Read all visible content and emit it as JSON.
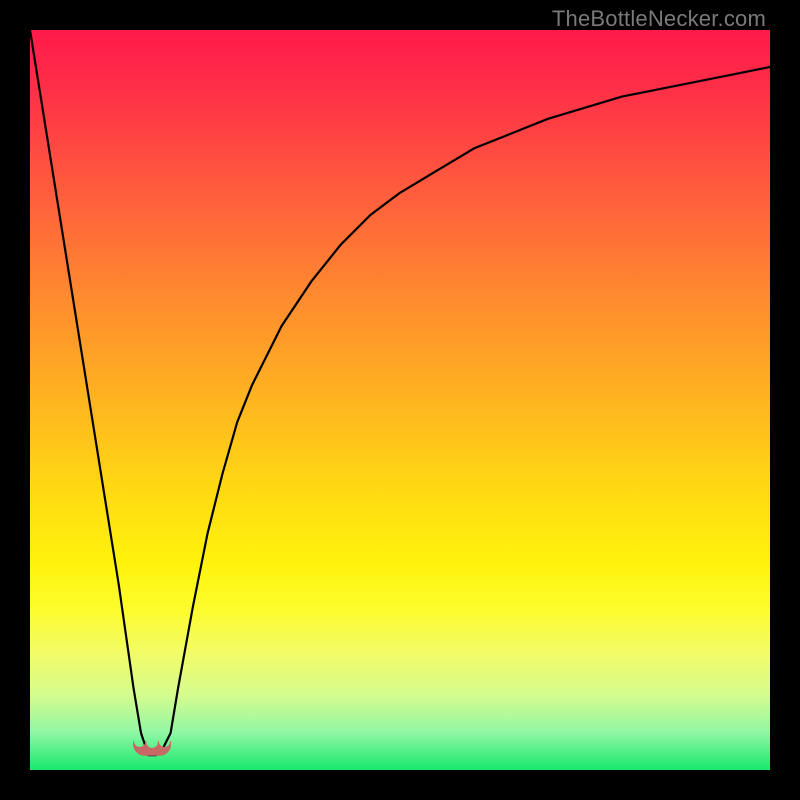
{
  "watermark": "TheBottleNecker.com",
  "chart_data": {
    "type": "line",
    "title": "",
    "xlabel": "",
    "ylabel": "",
    "xlim": [
      0,
      100
    ],
    "ylim": [
      0,
      100
    ],
    "note": "Axes are unlabeled in the source image; values are normalized 0–100. The curve depicts bottleneck deviation: a sharp V reaching ~0 at x≈16, then rising asymptotically toward ~95 at the right edge.",
    "series": [
      {
        "name": "bottleneck-curve",
        "x": [
          0,
          4,
          8,
          12,
          14,
          15,
          16,
          17,
          18,
          19,
          20,
          22,
          24,
          26,
          28,
          30,
          34,
          38,
          42,
          46,
          50,
          55,
          60,
          65,
          70,
          75,
          80,
          85,
          90,
          95,
          100
        ],
        "y": [
          100,
          75,
          50,
          25,
          11,
          5,
          2,
          2,
          3,
          5,
          11,
          22,
          32,
          40,
          47,
          52,
          60,
          66,
          71,
          75,
          78,
          81,
          84,
          86,
          88,
          89.5,
          91,
          92,
          93,
          94,
          95
        ]
      }
    ],
    "marker": {
      "name": "optimal-point",
      "x_range": [
        14,
        19
      ],
      "y": 2,
      "color": "#c76a66"
    }
  }
}
